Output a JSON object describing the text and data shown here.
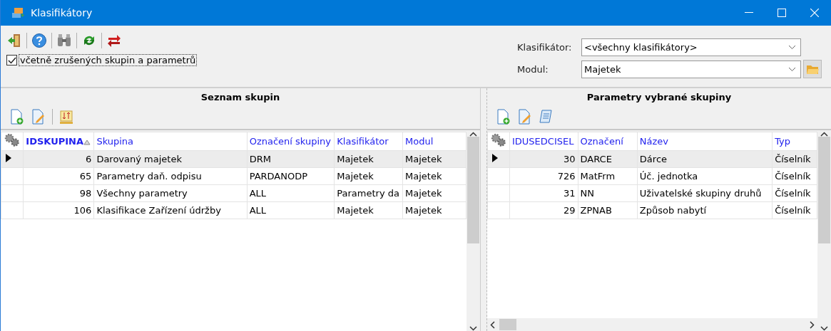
{
  "window": {
    "title": "Klasifikátory"
  },
  "toolbar": {
    "include_cancelled": {
      "label": "včetně zrušených skupin a parametrů",
      "checked": true
    }
  },
  "filters": [
    {
      "label": "Klasifikátor:",
      "value": "<všechny klasifikátory>",
      "kind": "combo"
    },
    {
      "label": "Modul:",
      "value": "Majetek",
      "kind": "combo-folder"
    }
  ],
  "groups_panel": {
    "title": "Seznam skupin",
    "table": {
      "columns": [
        {
          "label": "IDSKUPINA",
          "sorted": true
        },
        {
          "label": "Skupina",
          "sorted": false
        },
        {
          "label": "Označení skupiny",
          "sorted": false
        },
        {
          "label": "Klasifikátor",
          "sorted": false
        },
        {
          "label": "Modul",
          "sorted": false
        }
      ],
      "rows": [
        {
          "selected": true,
          "cells": [
            "6",
            "Darovaný majetek",
            "DRM",
            "Majetek",
            "Majetek"
          ]
        },
        {
          "selected": false,
          "cells": [
            "65",
            "Parametry daň. odpisu",
            "PARDANODP",
            "Majetek",
            "Majetek"
          ]
        },
        {
          "selected": false,
          "cells": [
            "98",
            "Všechny parametry",
            "ALL",
            "Parametry da",
            "Majetek"
          ]
        },
        {
          "selected": false,
          "cells": [
            "106",
            "Klasifikace Zařízení údržby",
            "ALL",
            "Majetek",
            "Majetek"
          ]
        }
      ]
    }
  },
  "params_panel": {
    "title": "Parametry vybrané skupiny",
    "table": {
      "columns": [
        {
          "label": "IDUSEDCISEL",
          "sorted": false
        },
        {
          "label": "Označení",
          "sorted": false
        },
        {
          "label": "Název",
          "sorted": false
        },
        {
          "label": "Typ",
          "sorted": false
        }
      ],
      "rows": [
        {
          "selected": true,
          "cells": [
            "30",
            "DARCE",
            "Dárce",
            "Číselník"
          ]
        },
        {
          "selected": false,
          "cells": [
            "726",
            "MatFrm",
            "Úč. jednotka",
            "Číselník"
          ]
        },
        {
          "selected": false,
          "cells": [
            "31",
            "NN",
            "Uživatelské skupiny druhů",
            "Číselník"
          ]
        },
        {
          "selected": false,
          "cells": [
            "29",
            "ZPNAB",
            "Způsob nabytí",
            "Číselník"
          ]
        }
      ]
    }
  }
}
